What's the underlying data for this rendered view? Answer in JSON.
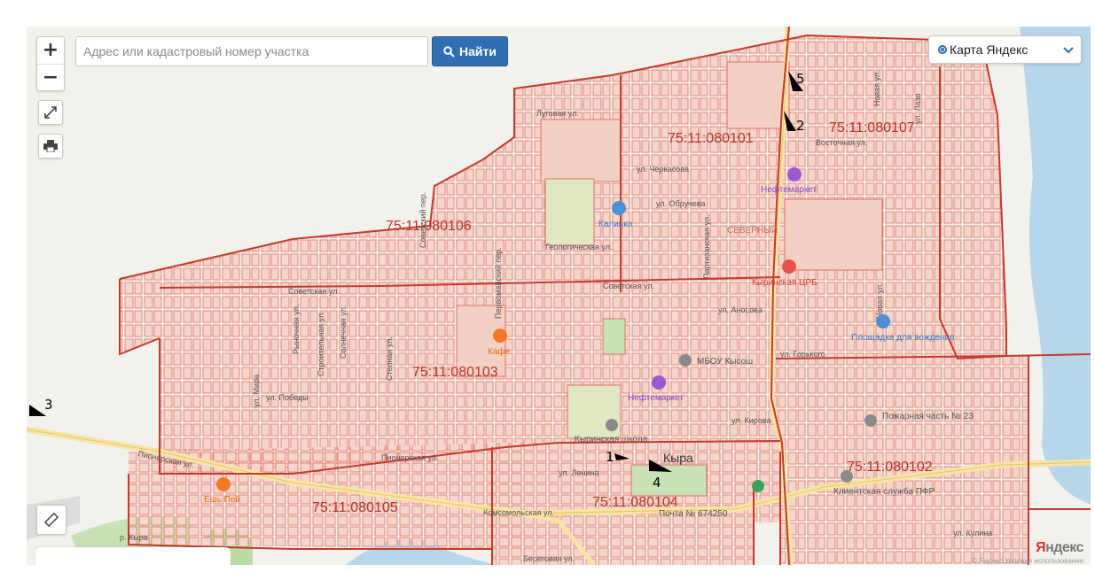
{
  "search": {
    "placeholder": "Адрес или кадастровый номер участка",
    "value": "",
    "button_label": "Найти"
  },
  "zoom": {
    "in_label": "+",
    "out_label": "−"
  },
  "icons": {
    "fullscreen": "expand-icon",
    "print": "printer-icon",
    "ruler": "ruler-icon",
    "search": "search-icon"
  },
  "layer_select": {
    "selected": "Карта Яндекс"
  },
  "cadastral_blocks": [
    "75:11:080101",
    "75:11:080107",
    "75:11:080106",
    "75:11:080103",
    "75:11:080102",
    "75:11:080104",
    "75:11:080105"
  ],
  "streets": [
    "Луговая ул.",
    "ул. Черкасова",
    "ул. Обручева",
    "Геологическая ул.",
    "Советская ул.",
    "ул. Аносова",
    "ул. Победы",
    "Пионерская ул.",
    "ул. Ленина",
    "Комсомольская ул.",
    "Береговая ул.",
    "Восточная ул.",
    "ул. Лазо",
    "Новая ул.",
    "Первомайский пер.",
    "ул. Горького",
    "Строительная ул.",
    "Солнечная ул.",
    "Степная ул.",
    "ул. Мира",
    "Рыночная ул.",
    "Партизанская ул.",
    "ул. Кирова",
    "Советская ул.",
    "Советский пер.",
    "Пионерская ул.",
    "ул. Кулина",
    "Новая ул."
  ],
  "pois": {
    "kafe": "Кафе",
    "kalinka": "Калинка",
    "neftemarket1": "Нефтемаркет",
    "neftemarket2": "Нефтемаркет",
    "crb": "Кыринская ЦРБ",
    "severny": "СЕВЕРНЫЙ",
    "ploschadka": "Площадка для вождения",
    "mbou": "МБОУ Кысош",
    "school": "Кыринская школа",
    "pozharnaya": "Пожарная часть № 23",
    "pfr": "Клиентская служба ПФР",
    "pochta": "Почта № 674250",
    "esh_pej": "Ешь Пей",
    "kyra": "Кыра",
    "kyra_river": "р. Кыра"
  },
  "point_markers": [
    "1",
    "2",
    "3",
    "4",
    "5"
  ],
  "attribution": {
    "logo_red": "Я",
    "logo_rest": "ндекс",
    "copyright": "© Яндекс  Условия использования"
  },
  "colors": {
    "parcel_fill": "#f6d6cc",
    "parcel_stroke": "#e0705f",
    "block_stroke": "#c43a2e",
    "road_main": "#f7e4a6",
    "water": "#b7d6ea",
    "park": "#c7e2b4",
    "button_blue": "#2f6db5"
  }
}
